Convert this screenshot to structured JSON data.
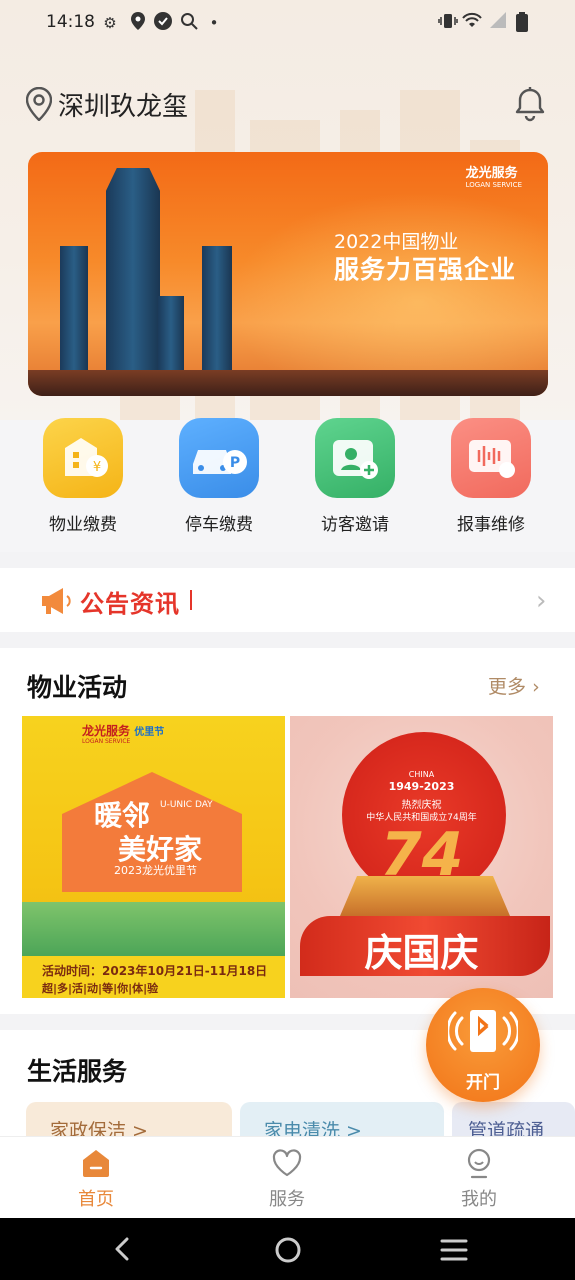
{
  "status_bar": {
    "time": "14:18",
    "icons": [
      "gear-icon",
      "location-icon",
      "check-icon",
      "search-icon",
      "dot-icon",
      "vibrate-icon",
      "wifi-icon",
      "signal-icon",
      "battery-icon"
    ]
  },
  "header": {
    "location": "深圳玖龙玺"
  },
  "banner": {
    "brand": "龙光服务",
    "brand2": "LOGAN SERVICE",
    "line1": "2022中国物业",
    "line2": "服务力百强企业"
  },
  "quick_actions": [
    {
      "label": "物业缴费",
      "icon": "property-fee-icon",
      "color": "#f7c227"
    },
    {
      "label": "停车缴费",
      "icon": "parking-fee-icon",
      "color": "#4a9ef5"
    },
    {
      "label": "访客邀请",
      "icon": "visitor-invite-icon",
      "color": "#45c178"
    },
    {
      "label": "报事维修",
      "icon": "repair-report-icon",
      "color": "#f4776a"
    }
  ],
  "notice": {
    "title": "公告资讯"
  },
  "activities": {
    "title": "物业活动",
    "more": "更多",
    "items": [
      {
        "brand": "龙光服务",
        "brand_en": "LOGAN SERVICE",
        "tag": "优里节",
        "headline1": "暖邻",
        "headline2": "美好家",
        "en": "U-UNIC DAY",
        "subtitle": "2023龙光优里节",
        "time_text": "活动时间：2023年10月21日-11月18日",
        "slogan": "超|多|活|动|等|你|体|验"
      },
      {
        "china": "CHINA",
        "years": "1949-2023",
        "celebrate": "热烈庆祝",
        "anniv": "中华人民共和国成立74周年",
        "number": "74",
        "headline": "庆国庆"
      }
    ]
  },
  "services": {
    "title": "生活服务",
    "tiles": [
      {
        "label": "家政保洁 >"
      },
      {
        "label": "家电清洗 >"
      },
      {
        "label": "管道疏通"
      }
    ]
  },
  "door_button": {
    "label": "开门"
  },
  "tabbar": {
    "tabs": [
      {
        "label": "首页",
        "active": true
      },
      {
        "label": "服务",
        "active": false
      },
      {
        "label": "我的",
        "active": false
      }
    ]
  },
  "colors": {
    "accent": "#f27418",
    "active_tab": "#e8883a",
    "inactive_tab": "#888888",
    "notice_red": "#e5352a",
    "more_gold": "#b08b66"
  }
}
